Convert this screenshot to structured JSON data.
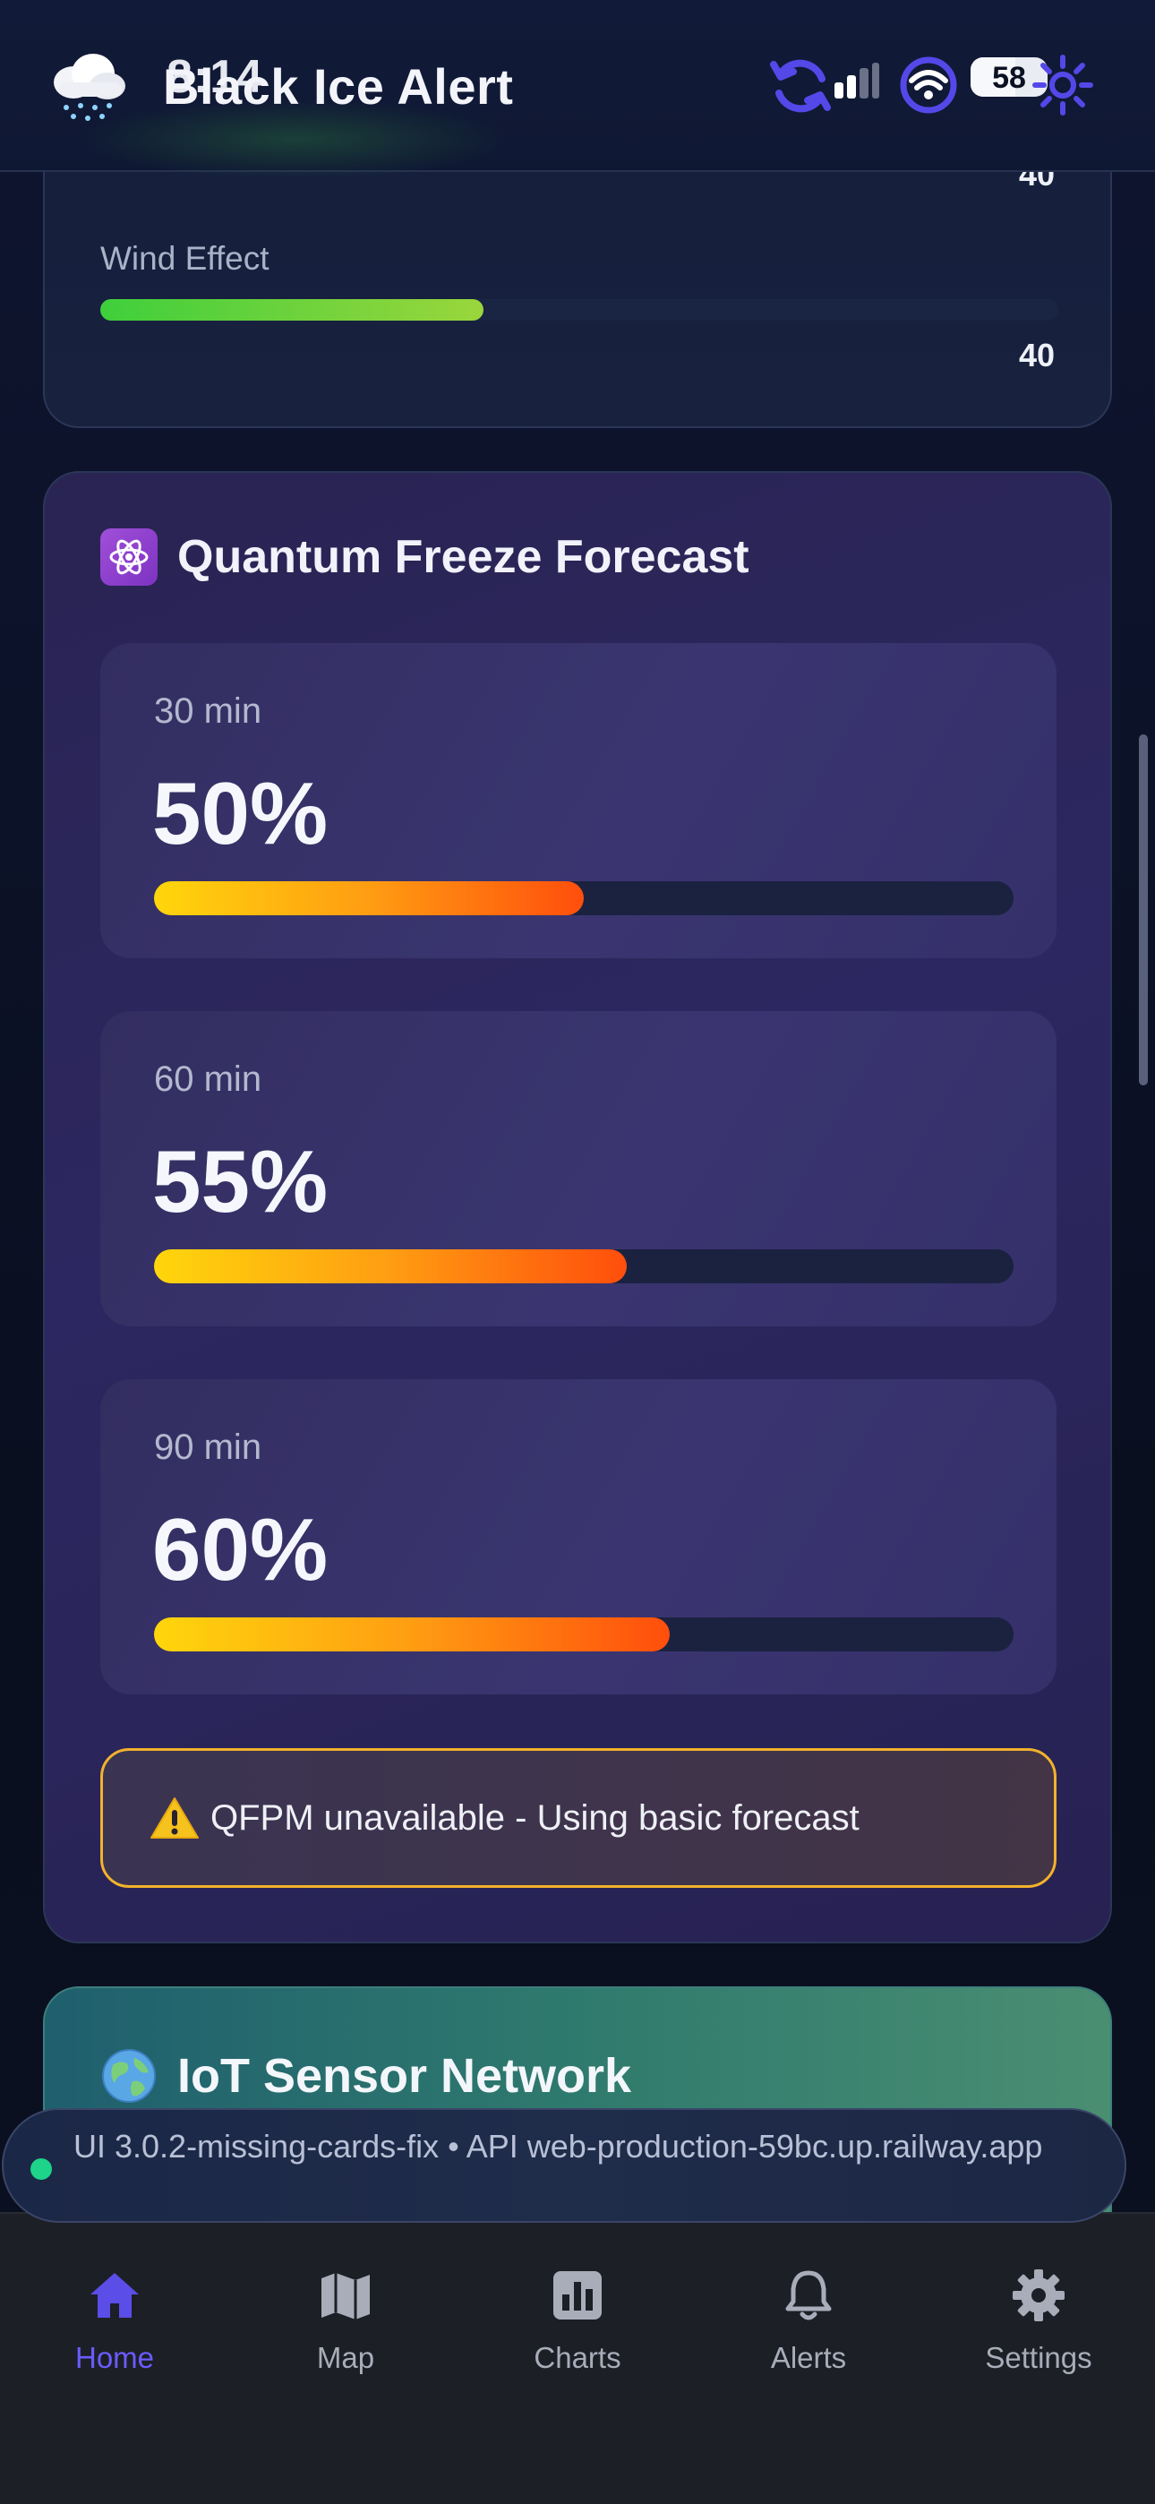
{
  "status_bar": {
    "time": "8:14",
    "battery": "58",
    "battery_level": 0.58
  },
  "header": {
    "title": "Black Ice Alert",
    "logo_icon": "snow-cloud-icon",
    "sync_icon": "sync-icon",
    "wifi_icon": "wifi-icon",
    "theme_icon": "sun-icon"
  },
  "environment_card": {
    "previous_value": "40",
    "wind_effect": {
      "label": "Wind Effect",
      "value": "40",
      "level": 0.4,
      "color_start": "#3fcf3c",
      "color_end": "#9ad63c"
    }
  },
  "quantum": {
    "icon": "atom-icon",
    "title": "Quantum Freeze Forecast",
    "forecasts": [
      {
        "label": "30 min",
        "value": "50%",
        "level": 0.5
      },
      {
        "label": "60 min",
        "value": "55%",
        "level": 0.55
      },
      {
        "label": "90 min",
        "value": "60%",
        "level": 0.6
      }
    ],
    "warning": {
      "icon": "warning-icon",
      "text": "QFPM unavailable - Using basic forecast"
    },
    "colors": {
      "bar_start": "#ffd60c",
      "bar_end": "#ff4e0c",
      "warning_border": "#f3b22c"
    }
  },
  "iot": {
    "icon": "globe-icon",
    "title": "IoT Sensor Network"
  },
  "version": {
    "text": "UI 3.0.2-missing-cards-fix • API web-production-59bc.up.railway.app",
    "status_color": "#1ed38a"
  },
  "nav": {
    "items": [
      {
        "label": "Home",
        "icon": "home-icon",
        "active": true
      },
      {
        "label": "Map",
        "icon": "map-icon",
        "active": false
      },
      {
        "label": "Charts",
        "icon": "chart-icon",
        "active": false
      },
      {
        "label": "Alerts",
        "icon": "bell-icon",
        "active": false
      },
      {
        "label": "Settings",
        "icon": "gear-icon",
        "active": false
      }
    ],
    "active_color": "#6a5cff"
  }
}
